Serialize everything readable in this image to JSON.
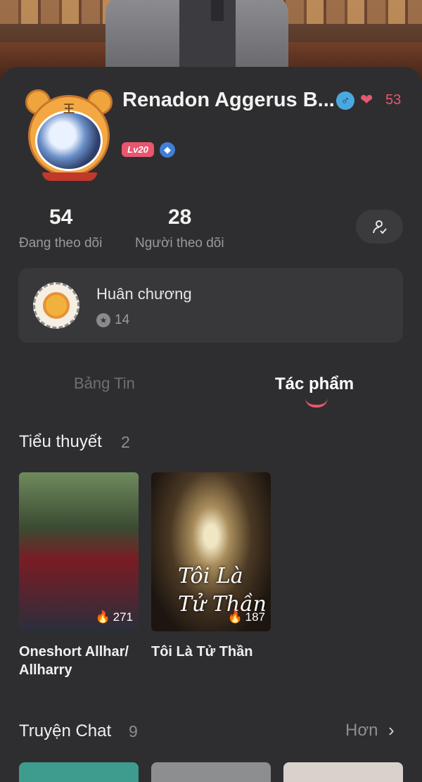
{
  "profile": {
    "name": "Renadon Aggerus B...",
    "gender_icon": "♂",
    "hearts": "53",
    "level": "Lv20"
  },
  "stats": {
    "following_count": "54",
    "following_label": "Đang theo dõi",
    "followers_count": "28",
    "followers_label": "Người theo dõi"
  },
  "medals": {
    "title": "Huân chương",
    "count": "14"
  },
  "tabs": [
    {
      "label": "Bảng Tin",
      "active": false
    },
    {
      "label": "Tác phẩm",
      "active": true
    }
  ],
  "novels": {
    "title": "Tiểu thuyết",
    "count": "2",
    "items": [
      {
        "title": "Oneshort Allhar/ Allharry",
        "views": "271"
      },
      {
        "title": "Tôi Là Tử Thần",
        "views": "187",
        "cover_text": "Tôi Là Tử Thần"
      }
    ]
  },
  "chat_stories": {
    "title": "Truyện Chat",
    "count": "9",
    "more_label": "Hơn"
  },
  "colors": {
    "accent": "#e8566f",
    "background": "#2e2e30"
  }
}
